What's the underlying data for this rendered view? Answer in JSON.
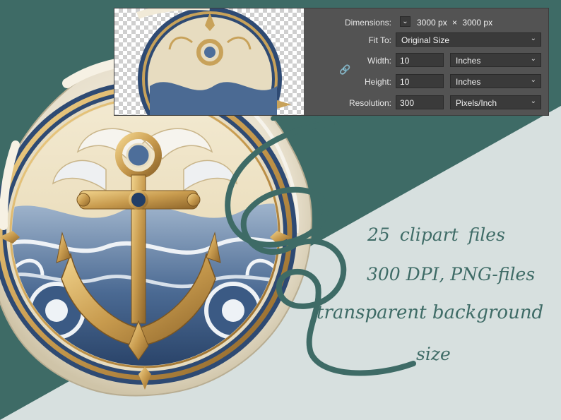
{
  "image_size_panel": {
    "dimensions": {
      "label": "Dimensions:",
      "width_value": "3000 px",
      "separator": "×",
      "height_value": "3000 px"
    },
    "fit_to": {
      "label": "Fit To:",
      "value": "Original Size"
    },
    "width": {
      "label": "Width:",
      "value": "10",
      "unit": "Inches"
    },
    "height": {
      "label": "Height:",
      "value": "10",
      "unit": "Inches"
    },
    "resolution": {
      "label": "Resolution:",
      "value": "300",
      "unit": "Pixels/Inch"
    },
    "icons": {
      "constrain": "link-icon",
      "dimensions_toggle": "chevron-down-icon",
      "dropdown": "chevron-down-icon"
    }
  },
  "promo": {
    "line1": "25  clipart  files",
    "line2": "300 DPI, PNG-files",
    "line3": "transparent background",
    "line4": "size"
  },
  "colors": {
    "teal": "#3e6b66",
    "background": "#d6dfde",
    "panel": "#535353",
    "gold": "#c8a25a",
    "navy": "#2e4a73",
    "pearl": "#ece6d6"
  }
}
